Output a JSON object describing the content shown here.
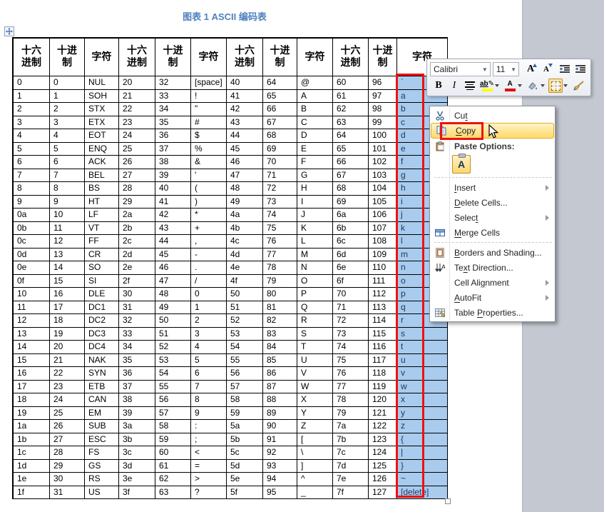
{
  "title": "图表 1 ASCII 编码表",
  "colors": {
    "annotation_red": "#ee1111",
    "selection_blue": "#a9cbee",
    "title_blue": "#4f81bd",
    "menu_highlight": "#ffd968"
  },
  "mini_toolbar": {
    "font_name": "Calibri",
    "font_size": "11",
    "bold_label": "B",
    "italic_label": "I",
    "highlight_label": "ab",
    "font_color_label": "A"
  },
  "table": {
    "header_cells": [
      [
        "十六",
        "进制"
      ],
      [
        "十进",
        "制"
      ],
      [
        "字符"
      ],
      [
        "十六",
        "进制"
      ],
      [
        "十进",
        "制"
      ],
      [
        "字符"
      ],
      [
        "十六",
        "进制"
      ],
      [
        "十进",
        "制"
      ],
      [
        "字符"
      ],
      [
        "十六",
        "进制"
      ],
      [
        "十进",
        "制"
      ],
      [
        "字符"
      ]
    ],
    "selected_column_index": 11,
    "rows": [
      [
        "0",
        "0",
        "NUL",
        "20",
        "32",
        "[space]",
        "40",
        "64",
        "@",
        "60",
        "96",
        "`"
      ],
      [
        "1",
        "1",
        "SOH",
        "21",
        "33",
        "!",
        "41",
        "65",
        "A",
        "61",
        "97",
        "a"
      ],
      [
        "2",
        "2",
        "STX",
        "22",
        "34",
        "\"",
        "42",
        "66",
        "B",
        "62",
        "98",
        "b"
      ],
      [
        "3",
        "3",
        "ETX",
        "23",
        "35",
        "#",
        "43",
        "67",
        "C",
        "63",
        "99",
        "c"
      ],
      [
        "4",
        "4",
        "EOT",
        "24",
        "36",
        "$",
        "44",
        "68",
        "D",
        "64",
        "100",
        "d"
      ],
      [
        "5",
        "5",
        "ENQ",
        "25",
        "37",
        "%",
        "45",
        "69",
        "E",
        "65",
        "101",
        "e"
      ],
      [
        "6",
        "6",
        "ACK",
        "26",
        "38",
        "&",
        "46",
        "70",
        "F",
        "66",
        "102",
        "f"
      ],
      [
        "7",
        "7",
        "BEL",
        "27",
        "39",
        "'",
        "47",
        "71",
        "G",
        "67",
        "103",
        "g"
      ],
      [
        "8",
        "8",
        "BS",
        "28",
        "40",
        "(",
        "48",
        "72",
        "H",
        "68",
        "104",
        "h"
      ],
      [
        "9",
        "9",
        "HT",
        "29",
        "41",
        ")",
        "49",
        "73",
        "I",
        "69",
        "105",
        "i"
      ],
      [
        "0a",
        "10",
        "LF",
        "2a",
        "42",
        "*",
        "4a",
        "74",
        "J",
        "6a",
        "106",
        "j"
      ],
      [
        "0b",
        "11",
        "VT",
        "2b",
        "43",
        "+",
        "4b",
        "75",
        "K",
        "6b",
        "107",
        "k"
      ],
      [
        "0c",
        "12",
        "FF",
        "2c",
        "44",
        ",",
        "4c",
        "76",
        "L",
        "6c",
        "108",
        "l"
      ],
      [
        "0d",
        "13",
        "CR",
        "2d",
        "45",
        "-",
        "4d",
        "77",
        "M",
        "6d",
        "109",
        "m"
      ],
      [
        "0e",
        "14",
        "SO",
        "2e",
        "46",
        ".",
        "4e",
        "78",
        "N",
        "6e",
        "110",
        "n"
      ],
      [
        "0f",
        "15",
        "SI",
        "2f",
        "47",
        "/",
        "4f",
        "79",
        "O",
        "6f",
        "111",
        "o"
      ],
      [
        "10",
        "16",
        "DLE",
        "30",
        "48",
        "0",
        "50",
        "80",
        "P",
        "70",
        "112",
        "p"
      ],
      [
        "11",
        "17",
        "DC1",
        "31",
        "49",
        "1",
        "51",
        "81",
        "Q",
        "71",
        "113",
        "q"
      ],
      [
        "12",
        "18",
        "DC2",
        "32",
        "50",
        "2",
        "52",
        "82",
        "R",
        "72",
        "114",
        "r"
      ],
      [
        "13",
        "19",
        "DC3",
        "33",
        "51",
        "3",
        "53",
        "83",
        "S",
        "73",
        "115",
        "s"
      ],
      [
        "14",
        "20",
        "DC4",
        "34",
        "52",
        "4",
        "54",
        "84",
        "T",
        "74",
        "116",
        "t"
      ],
      [
        "15",
        "21",
        "NAK",
        "35",
        "53",
        "5",
        "55",
        "85",
        "U",
        "75",
        "117",
        "u"
      ],
      [
        "16",
        "22",
        "SYN",
        "36",
        "54",
        "6",
        "56",
        "86",
        "V",
        "76",
        "118",
        "v"
      ],
      [
        "17",
        "23",
        "ETB",
        "37",
        "55",
        "7",
        "57",
        "87",
        "W",
        "77",
        "119",
        "w"
      ],
      [
        "18",
        "24",
        "CAN",
        "38",
        "56",
        "8",
        "58",
        "88",
        "X",
        "78",
        "120",
        "x"
      ],
      [
        "19",
        "25",
        "EM",
        "39",
        "57",
        "9",
        "59",
        "89",
        "Y",
        "79",
        "121",
        "y"
      ],
      [
        "1a",
        "26",
        "SUB",
        "3a",
        "58",
        ":",
        "5a",
        "90",
        "Z",
        "7a",
        "122",
        "z"
      ],
      [
        "1b",
        "27",
        "ESC",
        "3b",
        "59",
        ";",
        "5b",
        "91",
        "[",
        "7b",
        "123",
        "{"
      ],
      [
        "1c",
        "28",
        "FS",
        "3c",
        "60",
        "<",
        "5c",
        "92",
        "\\",
        "7c",
        "124",
        "|"
      ],
      [
        "1d",
        "29",
        "GS",
        "3d",
        "61",
        "=",
        "5d",
        "93",
        "]",
        "7d",
        "125",
        "}"
      ],
      [
        "1e",
        "30",
        "RS",
        "3e",
        "62",
        ">",
        "5e",
        "94",
        "^",
        "7e",
        "126",
        "~"
      ],
      [
        "1f",
        "31",
        "US",
        "3f",
        "63",
        "?",
        "5f",
        "95",
        "_",
        "7f",
        "127",
        "[delete]"
      ]
    ]
  },
  "context_menu": {
    "items": [
      {
        "name": "cut",
        "icon": "scissors-icon",
        "pre": "Cu",
        "key": "t",
        "post": ""
      },
      {
        "name": "copy",
        "icon": "copy-icon",
        "pre": "",
        "key": "C",
        "post": "opy",
        "highlighted": true
      },
      {
        "name": "paste-options-header",
        "icon": "paste-icon",
        "type": "header",
        "label": "Paste Options:"
      },
      {
        "name": "paste-keep-text-only",
        "type": "paste-a",
        "label": "A"
      },
      {
        "type": "separator"
      },
      {
        "name": "insert",
        "pre": "",
        "key": "I",
        "post": "nsert",
        "submenu": true
      },
      {
        "name": "delete-cells",
        "pre": "",
        "key": "D",
        "post": "elete Cells..."
      },
      {
        "name": "select",
        "pre": "Selec",
        "key": "t",
        "post": "",
        "submenu": true
      },
      {
        "name": "merge-cells",
        "icon": "merge-cells-icon",
        "pre": "",
        "key": "M",
        "post": "erge Cells"
      },
      {
        "type": "separator"
      },
      {
        "name": "borders-and-shading",
        "icon": "borders-shading-icon",
        "pre": "",
        "key": "B",
        "post": "orders and Shading..."
      },
      {
        "name": "text-direction",
        "icon": "text-direction-icon",
        "pre": "Te",
        "key": "x",
        "post": "t Direction..."
      },
      {
        "name": "cell-alignment",
        "pre": "Cell Ali",
        "key": "g",
        "post": "nment",
        "submenu": true
      },
      {
        "name": "autofit",
        "pre": "",
        "key": "A",
        "post": "utoFit",
        "submenu": true
      },
      {
        "name": "table-properties",
        "icon": "table-properties-icon",
        "pre": "Table ",
        "key": "P",
        "post": "roperties..."
      }
    ]
  }
}
